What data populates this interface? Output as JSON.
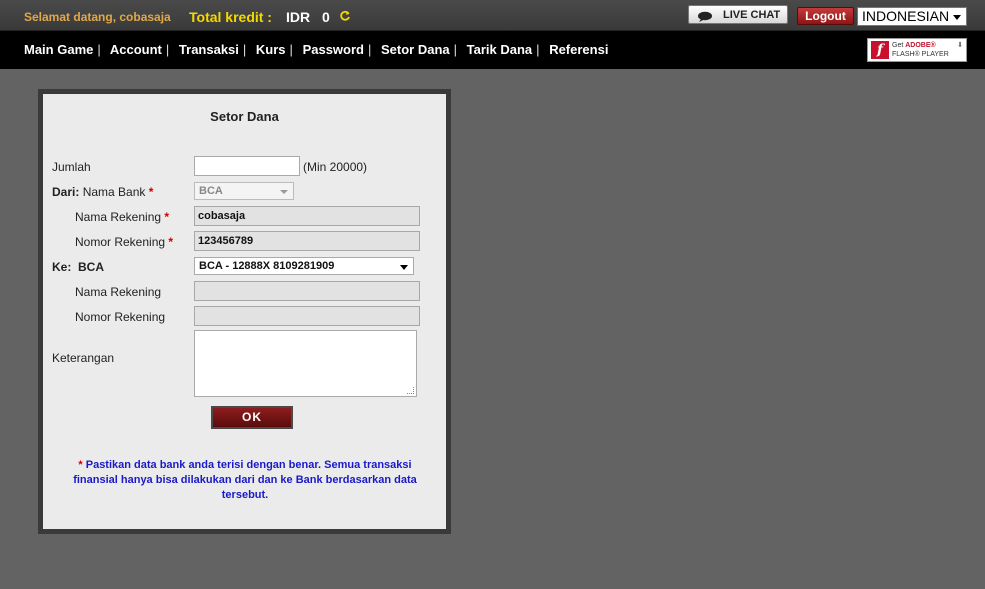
{
  "topbar": {
    "welcome": "Selamat datang, cobasaja",
    "credit_label": "Total kredit :",
    "currency": "IDR",
    "credit_value": "0",
    "live_chat": "LIVE CHAT",
    "logout": "Logout",
    "language": "INDONESIAN"
  },
  "nav": {
    "items": [
      "Main Game",
      "Account",
      "Transaksi",
      "Kurs",
      "Password",
      "Setor Dana",
      "Tarik Dana",
      "Referensi"
    ],
    "separator": "|"
  },
  "flash_badge": {
    "get": "Get",
    "adobe": "ADOBE®",
    "player": "FLASH® PLAYER"
  },
  "form": {
    "title": "Setor Dana",
    "jumlah_label": "Jumlah",
    "jumlah_value": "",
    "min_note": "(Min 20000)",
    "dari_label": "Dari:",
    "nama_bank_label": "Nama Bank",
    "nama_bank_value": "BCA",
    "nama_rekening_label": "Nama Rekening",
    "nama_rekening_value": "cobasaja",
    "nomor_rekening_label": "Nomor Rekening",
    "nomor_rekening_value": "123456789",
    "ke_label": "Ke:",
    "ke_bank": "BCA",
    "ke_select_value": "BCA - 12888X 8109281909",
    "ke_nama_rekening_label": "Nama Rekening",
    "ke_nama_rekening_value": "",
    "ke_nomor_rekening_label": "Nomor Rekening",
    "ke_nomor_rekening_value": "",
    "keterangan_label": "Keterangan",
    "keterangan_value": "",
    "required_mark": "*",
    "ok_button": "OK",
    "notice": "Pastikan data bank anda terisi dengan benar. Semua transaksi finansial hanya bisa dilakukan dari dan ke Bank berdasarkan data tersebut."
  },
  "colors": {
    "background": "#636363",
    "credit_label": "#f5d800",
    "welcome": "#e0a84a",
    "notice": "#1a1ac8",
    "required": "#d00000",
    "ok_button": "#7a1515"
  }
}
